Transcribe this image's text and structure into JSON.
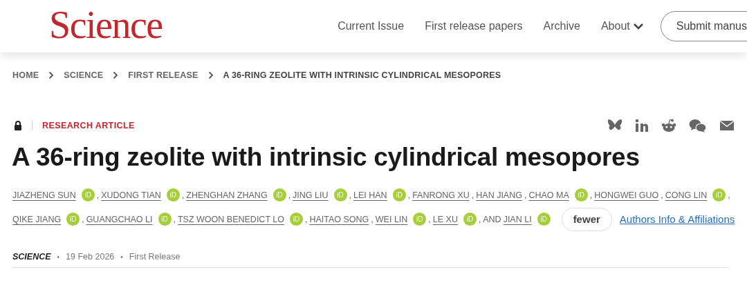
{
  "header": {
    "logo": "Science",
    "nav": [
      {
        "label": "Current Issue",
        "kind": "link"
      },
      {
        "label": "First release papers",
        "kind": "link"
      },
      {
        "label": "Archive",
        "kind": "link"
      },
      {
        "label": "About",
        "kind": "menu"
      }
    ],
    "submit": "Submit manus"
  },
  "breadcrumbs": [
    {
      "label": "HOME",
      "current": false
    },
    {
      "label": "SCIENCE",
      "current": false
    },
    {
      "label": "FIRST RELEASE",
      "current": false
    },
    {
      "label": "A 36-RING ZEOLITE WITH INTRINSIC CYLINDRICAL MESOPORES",
      "current": true
    }
  ],
  "article_type": "RESEARCH ARTICLE",
  "locked": true,
  "share": [
    {
      "kind": "bluesky"
    },
    {
      "kind": "linkedin"
    },
    {
      "kind": "reddit"
    },
    {
      "kind": "wechat"
    },
    {
      "kind": "email"
    }
  ],
  "title": "A 36-ring zeolite with intrinsic cylindrical mesopores",
  "author_lines": [
    [
      {
        "name": "JIAZHENG SUN",
        "badge": "iD",
        "sep": ","
      },
      {
        "name": "XUDONG TIAN",
        "badge": "iD",
        "sep": ","
      },
      {
        "name": "ZHENGHAN ZHANG",
        "badge": "iD",
        "sep": ","
      },
      {
        "name": "JING LIU",
        "badge": "iD",
        "sep": ","
      },
      {
        "name": "LEI HAN",
        "badge": "iD",
        "sep": ","
      },
      {
        "name": "FANRONG XU",
        "sep": ","
      },
      {
        "name": "HAN JIANG",
        "sep": ","
      },
      {
        "name": "CHAO MA",
        "badge": "iD",
        "sep": ","
      },
      {
        "name": "HONGWEI GUO",
        "sep": ","
      },
      {
        "name": "CONG LIN",
        "badge": "iD",
        "sep": ","
      }
    ],
    [
      {
        "name": "QIKE JIANG",
        "badge": "iD",
        "sep": ","
      },
      {
        "name": "GUANGCHAO LI",
        "badge": "iD",
        "sep": ","
      },
      {
        "name": "TSZ WOON BENEDICT LO",
        "badge": "iD",
        "sep": ","
      },
      {
        "name": "HAITAO SONG",
        "sep": ","
      },
      {
        "name": "WEI LIN",
        "badge": "iD",
        "sep": ","
      },
      {
        "name": "LE XU",
        "badge": "iD",
        "sep": ", AND"
      },
      {
        "name": "JIAN LI",
        "badge": "iD"
      }
    ]
  ],
  "fewer": "fewer",
  "affiliations": "Authors Info & Affiliations",
  "meta": {
    "journal": "SCIENCE",
    "date": "19 Feb 2026",
    "status": "First Release",
    "dot": "•"
  }
}
